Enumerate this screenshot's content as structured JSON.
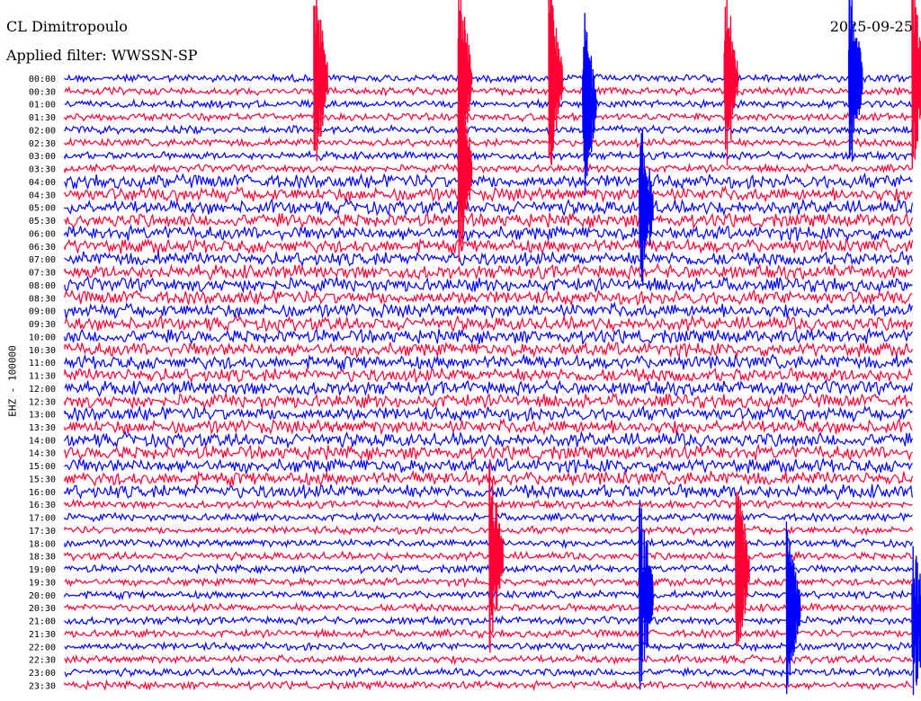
{
  "header": {
    "station": "CL Dimitropoulo",
    "date": "2025-09-25",
    "filter": "Applied filter: WWSSN-SP"
  },
  "channel_label": "EHZ - 100000",
  "colors": {
    "odd_line": "#0000ff",
    "even_line": "#ff0033"
  },
  "chart_data": {
    "type": "line",
    "title": "CL Dimitropoulo",
    "ylabel": "EHZ - 100000",
    "row_labels": [
      "00:00",
      "00:30",
      "01:00",
      "01:30",
      "02:00",
      "02:30",
      "03:00",
      "03:30",
      "04:00",
      "04:30",
      "05:00",
      "05:30",
      "06:00",
      "06:30",
      "07:00",
      "07:30",
      "08:00",
      "08:30",
      "09:00",
      "09:30",
      "10:00",
      "10:30",
      "11:00",
      "11:30",
      "12:00",
      "12:30",
      "13:00",
      "13:30",
      "14:00",
      "14:30",
      "15:00",
      "15:30",
      "16:00",
      "16:30",
      "17:00",
      "17:30",
      "18:00",
      "18:30",
      "19:00",
      "19:30",
      "20:00",
      "20:30",
      "21:00",
      "21:30",
      "22:00",
      "22:30",
      "23:00",
      "23:30"
    ],
    "x_range_minutes": [
      0,
      30
    ],
    "line_colors": [
      "#0000ff",
      "#ff0033"
    ],
    "events": [
      {
        "row": "00:00",
        "minute": 8.8,
        "color": "#ff0033"
      },
      {
        "row": "00:00",
        "minute": 13.9,
        "color": "#ff0033"
      },
      {
        "row": "00:00",
        "minute": 17.1,
        "color": "#ff0033"
      },
      {
        "row": "00:00",
        "minute": 23.3,
        "color": "#ff0033"
      },
      {
        "row": "00:00",
        "minute": 27.7,
        "color": "#0000ff"
      },
      {
        "row": "00:00",
        "minute": 30.0,
        "color": "#ff0033"
      },
      {
        "row": "01:00",
        "minute": 18.3,
        "color": "#0000ff"
      },
      {
        "row": "03:30",
        "minute": 13.9,
        "color": "#ff0033"
      },
      {
        "row": "05:00",
        "minute": 20.3,
        "color": "#0000ff"
      },
      {
        "row": "18:30",
        "minute": 15.0,
        "color": "#ff0033"
      },
      {
        "row": "19:00",
        "minute": 23.7,
        "color": "#ff0033"
      },
      {
        "row": "20:00",
        "minute": 20.3,
        "color": "#0000ff"
      },
      {
        "row": "20:30",
        "minute": 25.5,
        "color": "#0000ff"
      },
      {
        "row": "21:00",
        "minute": 34.4,
        "color": "#0000ff"
      }
    ]
  }
}
